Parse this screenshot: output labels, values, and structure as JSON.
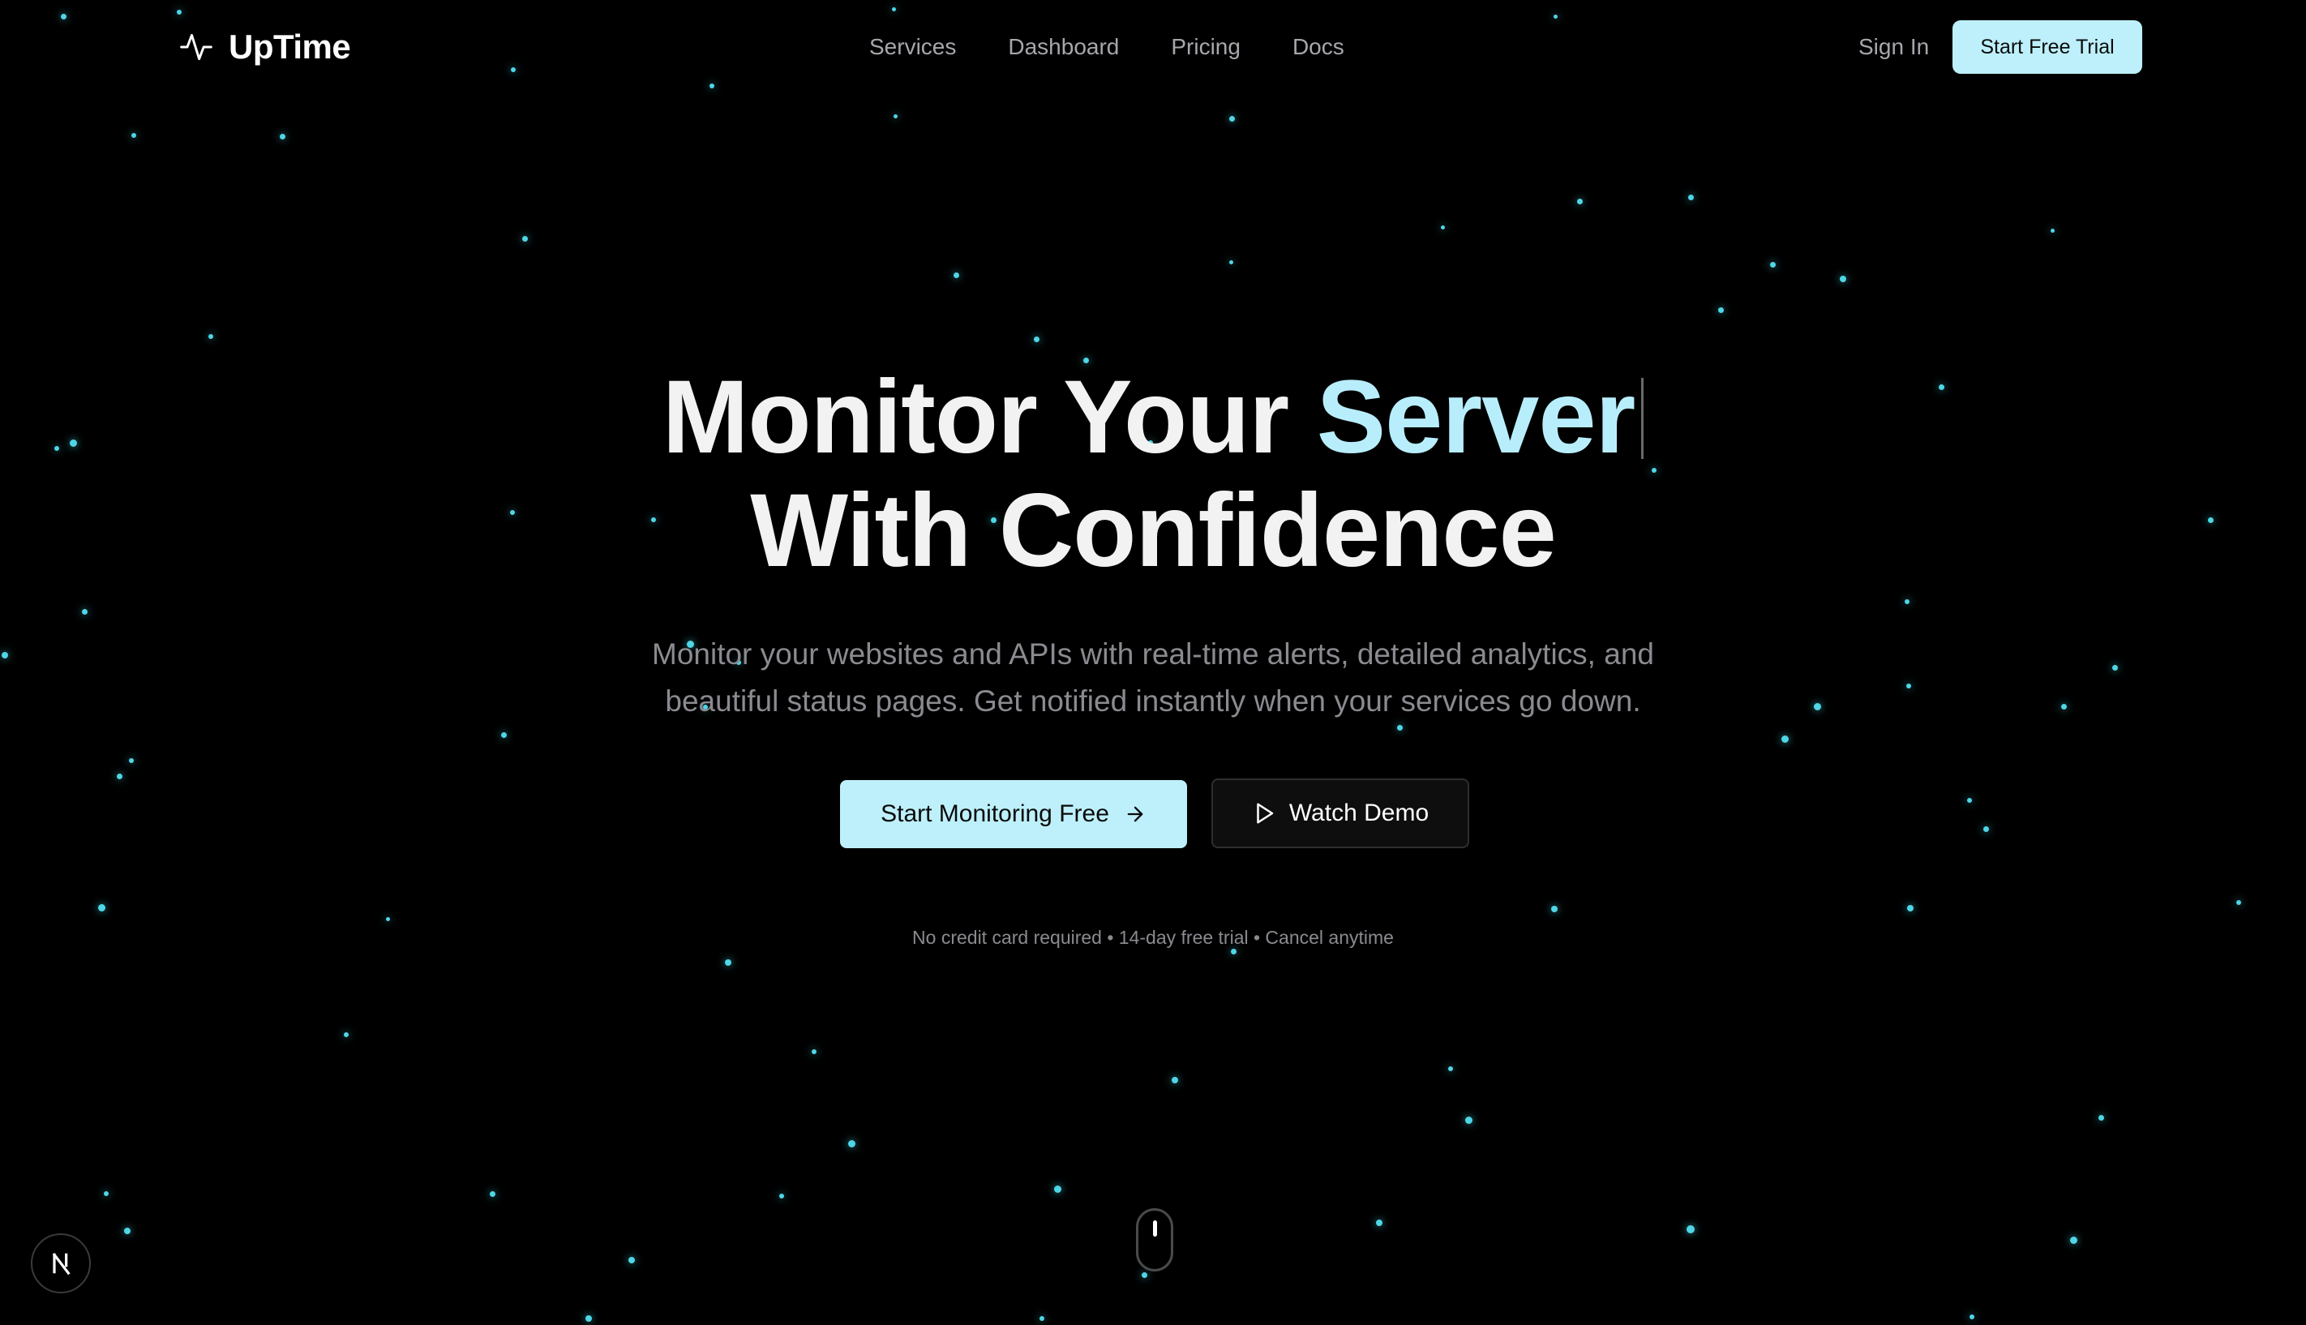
{
  "colors": {
    "background": "#000000",
    "accent": "#b8eefb",
    "particle": "#4fd6e6",
    "muted_text": "#8a8a90"
  },
  "brand": {
    "name": "UpTime",
    "icon": "activity-pulse-icon"
  },
  "nav": {
    "items": [
      "Services",
      "Dashboard",
      "Pricing",
      "Docs"
    ]
  },
  "header": {
    "sign_in": "Sign In",
    "cta": "Start Free Trial"
  },
  "hero": {
    "title_prefix": "Monitor Your",
    "title_accent": "Server",
    "title_line2": "With Confidence",
    "subtitle_line1": "Monitor your websites and APIs with real-time alerts, detailed analytics, and",
    "subtitle_line2": "beautiful status pages. Get notified instantly when your services go down.",
    "primary_cta": "Start Monitoring Free",
    "primary_cta_icon": "arrow-right-icon",
    "secondary_cta": "Watch Demo",
    "secondary_cta_icon": "play-icon",
    "fineprint": "No credit card required • 14-day free trial • Cancel anytime"
  },
  "scroll_indicator": {
    "icon": "mouse-scroll-icon"
  },
  "dev_badge": {
    "icon": "next-logo-icon",
    "letter": "N"
  }
}
